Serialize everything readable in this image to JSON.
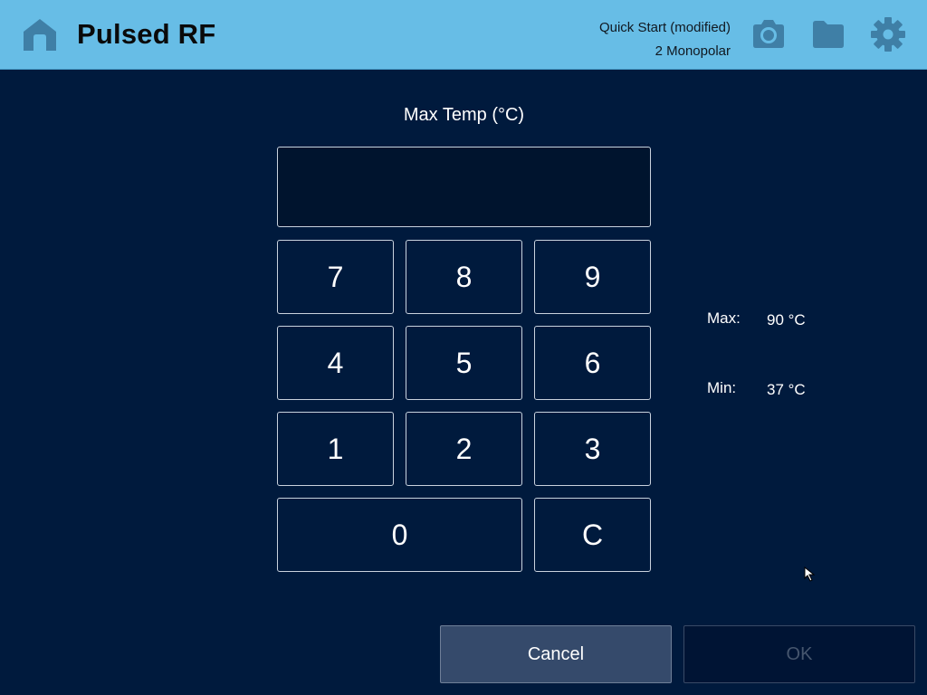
{
  "header": {
    "title": "Pulsed RF",
    "session_name": "Quick Start (modified)",
    "session_mode": "2 Monopolar",
    "icons": [
      "home-icon",
      "camera-icon",
      "folder-icon",
      "settings-gear-icon"
    ],
    "background_color": "#67bde6",
    "icon_color": "#3f7fa6"
  },
  "keypad": {
    "field_label": "Max Temp (°C)",
    "entry_value": "",
    "keys": {
      "k7": "7",
      "k8": "8",
      "k9": "9",
      "k4": "4",
      "k5": "5",
      "k6": "6",
      "k1": "1",
      "k2": "2",
      "k3": "3",
      "k0": "0",
      "clear": "C"
    }
  },
  "limits": {
    "max_label": "Max:",
    "max_value": "90 °C",
    "min_label": "Min:",
    "min_value": "37 °C"
  },
  "actions": {
    "cancel_label": "Cancel",
    "ok_label": "OK",
    "ok_enabled": false
  },
  "colors": {
    "background": "#001a3d",
    "key_border": "#c9d2de",
    "cancel_bg": "#354a6b",
    "ok_disabled_text": "#46566e"
  }
}
